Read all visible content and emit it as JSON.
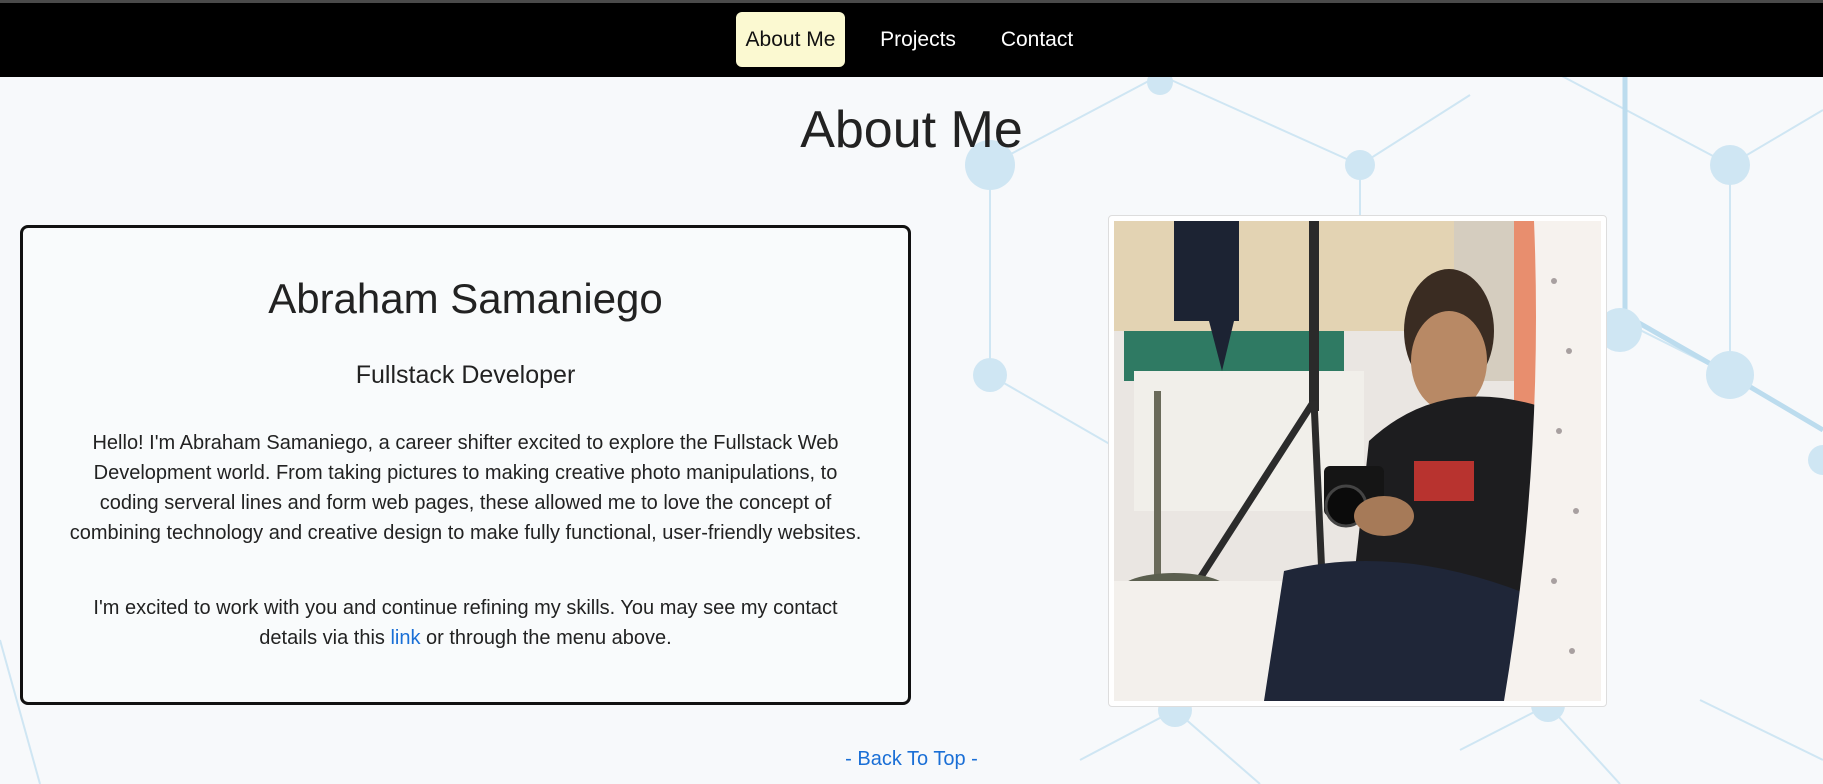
{
  "nav": {
    "items": [
      {
        "label": "About Me",
        "active": true
      },
      {
        "label": "Projects",
        "active": false
      },
      {
        "label": "Contact",
        "active": false
      }
    ]
  },
  "main": {
    "title": "About Me",
    "card": {
      "name": "Abraham Samaniego",
      "role": "Fullstack Developer",
      "paragraph1": "Hello! I'm Abraham Samaniego, a career shifter excited to explore the Fullstack Web Development world. From taking pictures to making creative photo manipulations, to coding serveral lines and form web pages, these allowed me to love the concept of combining technology and creative design to make fully functional, user-friendly websites.",
      "paragraph2_before": "I'm excited to work with you and continue refining my skills. You may see my contact details via this ",
      "paragraph2_link": "link",
      "paragraph2_after": " or through the menu above."
    },
    "back_to_top": "- Back To Top -"
  },
  "colors": {
    "navbar_bg": "#000000",
    "nav_active_bg": "#fbf9d1",
    "link": "#1a6fd6",
    "pattern": "#bfe0f2"
  }
}
